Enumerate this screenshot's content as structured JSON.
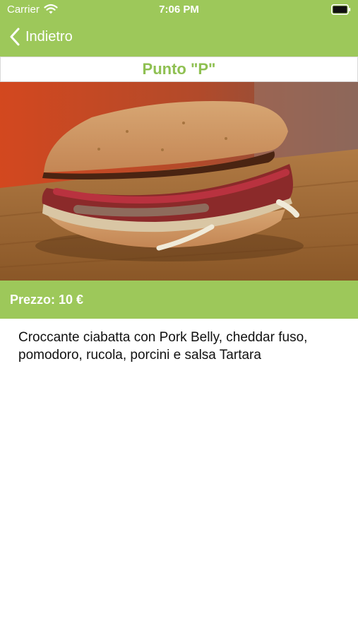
{
  "status_bar": {
    "carrier": "Carrier",
    "time": "7:06 PM"
  },
  "nav": {
    "back_label": "Indietro"
  },
  "product": {
    "title": "Punto \"P\"",
    "price": "Prezzo: 10 €",
    "description": "Croccante ciabatta con Pork Belly, cheddar fuso, pomodoro, rucola, porcini e salsa Tartara"
  },
  "colors": {
    "accent_green": "#9dc85a",
    "title_green": "#8fc052"
  },
  "icons": {
    "wifi": "wifi-icon",
    "battery": "battery-icon",
    "back": "chevron-left-icon"
  }
}
